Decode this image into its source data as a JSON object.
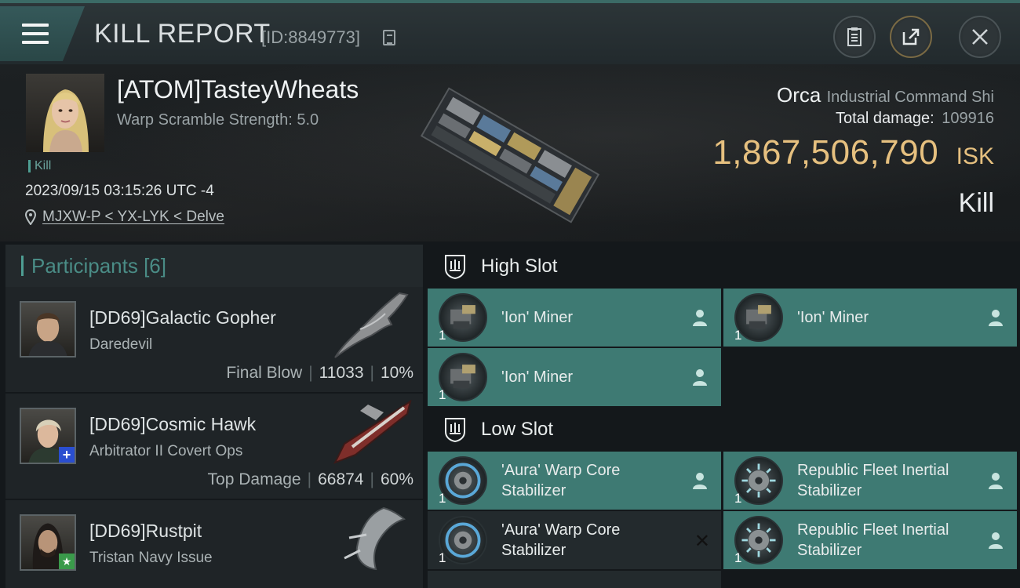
{
  "header": {
    "title": "KILL REPORT",
    "id_text": "[ID:8849773]"
  },
  "victim": {
    "pilot": "[ATOM]TasteyWheats",
    "warp_scramble": "Warp Scramble Strength: 5.0",
    "tag": "Kill",
    "datetime": "2023/09/15 03:15:26 UTC -4",
    "location": "MJXW-P < YX-LYK < Delve",
    "ship": "Orca",
    "ship_class": "Industrial Command Shi",
    "total_damage_label": "Total damage:",
    "total_damage": "109916",
    "isk_value": "1,867,506,790",
    "isk_unit": "ISK",
    "result": "Kill"
  },
  "participants": {
    "title": "Participants",
    "count": "[6]",
    "rows": [
      {
        "name": "[DD69]Galactic Gopher",
        "ship": "Daredevil",
        "label": "Final Blow",
        "damage": "11033",
        "percent": "10%"
      },
      {
        "name": "[DD69]Cosmic Hawk",
        "ship": "Arbitrator II Covert Ops",
        "label": "Top Damage",
        "damage": "66874",
        "percent": "60%"
      },
      {
        "name": "[DD69]Rustpit",
        "ship": "Tristan Navy Issue",
        "label": "",
        "damage": "",
        "percent": ""
      }
    ]
  },
  "modules": {
    "high_slot_title": "High Slot",
    "low_slot_title": "Low Slot",
    "high": [
      {
        "name": "'Ion' Miner",
        "qty": "1",
        "status": "dropped"
      },
      {
        "name": "'Ion' Miner",
        "qty": "1",
        "status": "dropped"
      },
      {
        "name": "'Ion' Miner",
        "qty": "1",
        "status": "dropped"
      }
    ],
    "low": [
      {
        "name": "'Aura' Warp Core Stabilizer",
        "qty": "1",
        "status": "dropped"
      },
      {
        "name": "Republic Fleet Inertial Stabilizer",
        "qty": "1",
        "status": "dropped"
      },
      {
        "name": "'Aura' Warp Core Stabilizer",
        "qty": "1",
        "status": "destroyed"
      },
      {
        "name": "Republic Fleet Inertial Stabilizer",
        "qty": "1",
        "status": "dropped"
      }
    ]
  },
  "colors": {
    "accent": "#4e9e93",
    "isk_gold": "#e6c07f",
    "dropped_bg": "#3e7a73"
  }
}
